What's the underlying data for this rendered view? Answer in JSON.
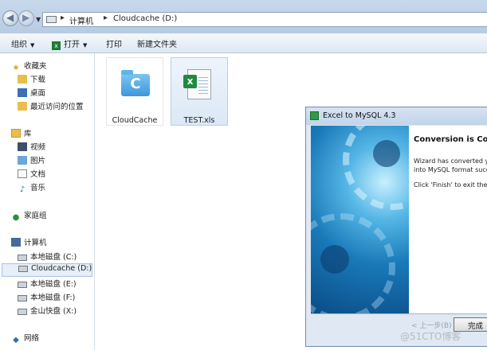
{
  "address_bar": {
    "crumbs": [
      "计算机",
      "Cloudcache (D:)"
    ],
    "separator": "▸"
  },
  "toolbar": {
    "organize": "组织",
    "open": "打开",
    "print": "打印",
    "new_folder": "新建文件夹"
  },
  "nav_pane": {
    "favorites": {
      "label": "收藏夹",
      "items": [
        "下载",
        "桌面",
        "最近访问的位置"
      ]
    },
    "libraries": {
      "label": "库",
      "items": [
        "视频",
        "图片",
        "文档",
        "音乐"
      ]
    },
    "homegroup": "家庭组",
    "computer": {
      "label": "计算机",
      "items": [
        "本地磁盘 (C:)",
        "Cloudcache (D:)",
        "本地磁盘 (E:)",
        "本地磁盘 (F:)",
        "金山快盘 (X:)"
      ]
    },
    "network": "网络"
  },
  "files": [
    {
      "name": "CloudCache",
      "icon": "cloudcache-folder-icon"
    },
    {
      "name": "TEST.xls",
      "icon": "excel-file-icon"
    }
  ],
  "dialog": {
    "title": "Excel to MySQL 4.3",
    "heading": "Conversion is Co",
    "text_line1": "Wizard has converted you",
    "text_line2": "into MySQL format succes",
    "text_line3": "Click 'Finish' to exit the wiz",
    "back_button": "< 上一步(B)",
    "finish_button": "完成"
  },
  "watermark": "@51CTO博客"
}
